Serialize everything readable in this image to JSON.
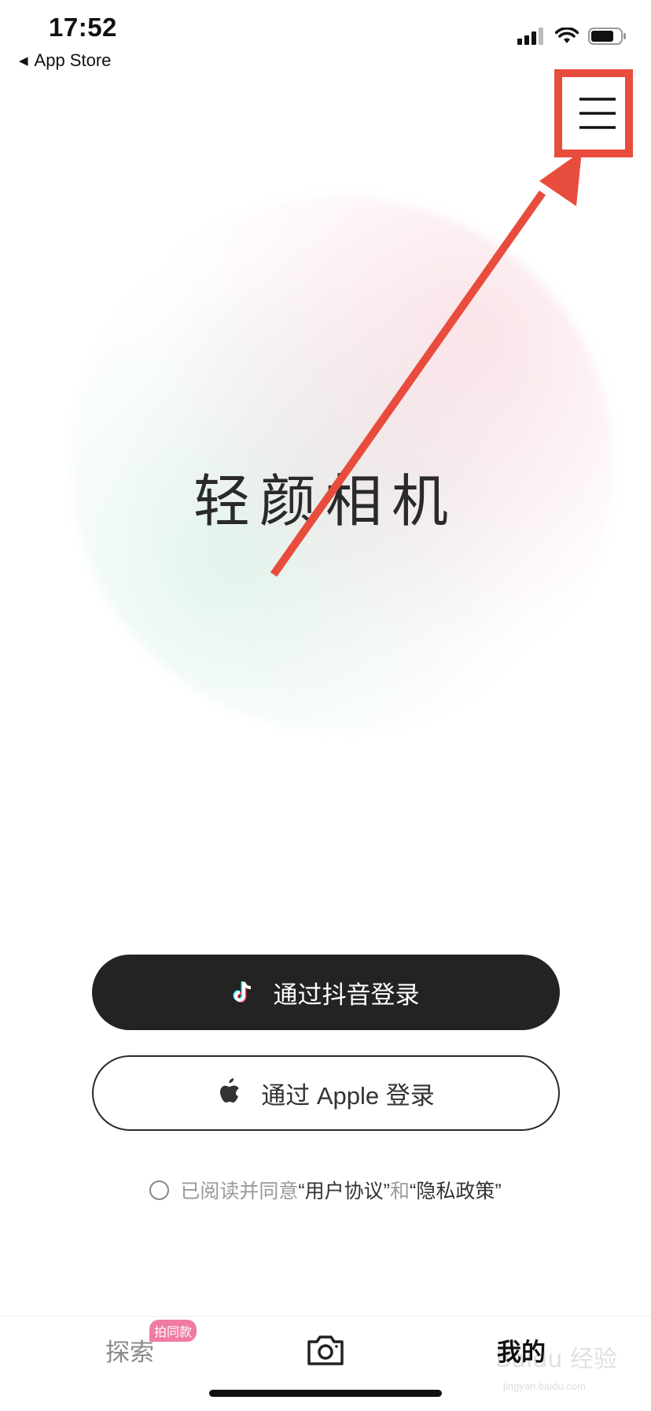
{
  "status_bar": {
    "time": "17:52",
    "back_app": "App Store",
    "icons": [
      "signal-icon",
      "wifi-icon",
      "battery-icon"
    ]
  },
  "header": {
    "menu_icon": "hamburger-menu-icon",
    "highlight_color": "#e84c3d"
  },
  "hero": {
    "app_name": "轻颜相机"
  },
  "login": {
    "douyin_button": "通过抖音登录",
    "apple_button": "通过 Apple 登录"
  },
  "agreement": {
    "prefix": "已阅读并同意",
    "user_agreement": "“用户协议”",
    "and": "和",
    "privacy_policy": "“隐私政策”"
  },
  "tab_bar": {
    "explore": "探索",
    "explore_badge": "拍同款",
    "camera_icon": "camera-icon",
    "me": "我的"
  },
  "watermark": {
    "text": "Baidu 经验",
    "sub": "jingyan.baidu.com"
  },
  "colors": {
    "annotation": "#e84c3d",
    "primary_button": "#232323",
    "badge": "#f07aa0"
  }
}
